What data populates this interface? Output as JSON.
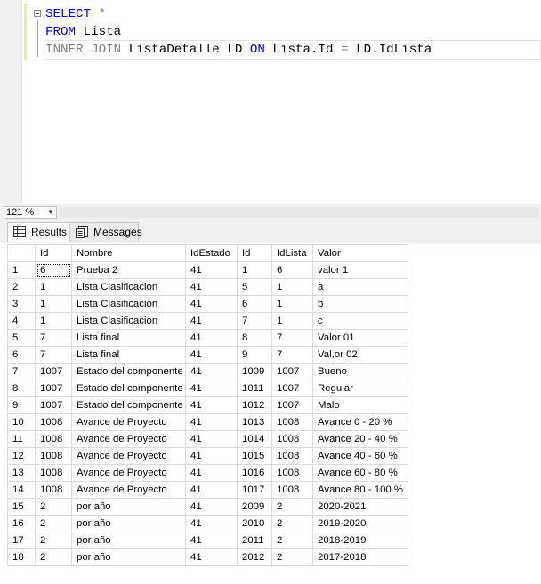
{
  "editor": {
    "lines": [
      [
        {
          "t": "SELECT",
          "c": "kw"
        },
        {
          "t": " *",
          "c": "gr"
        }
      ],
      [
        {
          "t": "FROM",
          "c": "kw"
        },
        {
          "t": " Lista",
          "c": "id"
        }
      ],
      [
        {
          "t": "INNER JOIN",
          "c": "gr"
        },
        {
          "t": " ListaDetalle LD ",
          "c": "id"
        },
        {
          "t": "ON",
          "c": "kw"
        },
        {
          "t": " Lista.Id ",
          "c": "id"
        },
        {
          "t": "=",
          "c": "gr"
        },
        {
          "t": " LD.IdLista",
          "c": "id"
        }
      ]
    ]
  },
  "zoom": {
    "value": "121 %"
  },
  "tabs": {
    "results_label": "Results",
    "messages_label": "Messages"
  },
  "grid": {
    "columns": [
      "Id",
      "Nombre",
      "IdEstado",
      "Id",
      "IdLista",
      "Valor"
    ],
    "rows": [
      [
        "1",
        "6",
        "Prueba 2",
        "41",
        "1",
        "6",
        "valor 1"
      ],
      [
        "2",
        "1",
        "Lista Clasificacion",
        "41",
        "5",
        "1",
        "a"
      ],
      [
        "3",
        "1",
        "Lista Clasificacion",
        "41",
        "6",
        "1",
        "b"
      ],
      [
        "4",
        "1",
        "Lista Clasificacion",
        "41",
        "7",
        "1",
        "c"
      ],
      [
        "5",
        "7",
        "Lista final",
        "41",
        "8",
        "7",
        "Valor 01"
      ],
      [
        "6",
        "7",
        "Lista final",
        "41",
        "9",
        "7",
        "Val,or 02"
      ],
      [
        "7",
        "1007",
        "Estado del componente",
        "41",
        "1009",
        "1007",
        "Bueno"
      ],
      [
        "8",
        "1007",
        "Estado del componente",
        "41",
        "1011",
        "1007",
        "Regular"
      ],
      [
        "9",
        "1007",
        "Estado del componente",
        "41",
        "1012",
        "1007",
        "Malo"
      ],
      [
        "10",
        "1008",
        "Avance de Proyecto",
        "41",
        "1013",
        "1008",
        "Avance 0 - 20 %"
      ],
      [
        "11",
        "1008",
        "Avance de Proyecto",
        "41",
        "1014",
        "1008",
        "Avance 20 - 40 %"
      ],
      [
        "12",
        "1008",
        "Avance de Proyecto",
        "41",
        "1015",
        "1008",
        "Avance 40 - 60 %"
      ],
      [
        "13",
        "1008",
        "Avance de Proyecto",
        "41",
        "1016",
        "1008",
        "Avance 60 - 80 %"
      ],
      [
        "14",
        "1008",
        "Avance de Proyecto",
        "41",
        "1017",
        "1008",
        "Avance 80 - 100 %"
      ],
      [
        "15",
        "2",
        "por año",
        "41",
        "2009",
        "2",
        "2020-2021"
      ],
      [
        "16",
        "2",
        "por año",
        "41",
        "2010",
        "2",
        "2019-2020"
      ],
      [
        "17",
        "2",
        "por año",
        "41",
        "2011",
        "2",
        "2018-2019"
      ],
      [
        "18",
        "2",
        "por año",
        "41",
        "2012",
        "2",
        "2017-2018"
      ]
    ]
  },
  "colors": {
    "keyword": "#0000ff",
    "operator": "#808080",
    "identifier": "#000000",
    "change_bar": "#f6e98a"
  }
}
